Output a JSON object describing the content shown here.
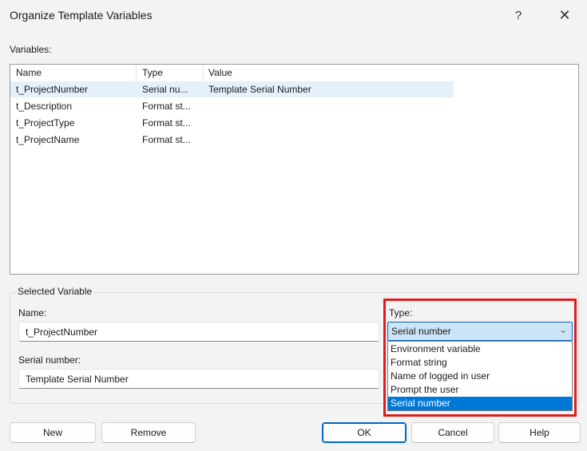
{
  "window": {
    "title": "Organize Template Variables",
    "help_glyph": "?",
    "close_glyph": "✕"
  },
  "variables": {
    "label": "Variables:",
    "columns": [
      "Name",
      "Type",
      "Value"
    ],
    "rows": [
      {
        "name": "t_ProjectNumber",
        "type": "Serial nu...",
        "value": "Template Serial Number"
      },
      {
        "name": "t_Description",
        "type": "Format st...",
        "value": ""
      },
      {
        "name": "t_ProjectType",
        "type": "Format st...",
        "value": ""
      },
      {
        "name": "t_ProjectName",
        "type": "Format st...",
        "value": ""
      }
    ],
    "selected_row": 0
  },
  "selected_variable": {
    "group_label": "Selected Variable",
    "name_label": "Name:",
    "name_value": "t_ProjectNumber",
    "serial_label": "Serial number:",
    "serial_value": "Template Serial Number",
    "type_label": "Type:",
    "type_value": "Serial number",
    "type_options": [
      "Environment variable",
      "Format string",
      "Name of logged in user",
      "Prompt the user",
      "Serial number"
    ],
    "type_selected_index": 4
  },
  "buttons": {
    "new": "New",
    "remove": "Remove",
    "ok": "OK",
    "cancel": "Cancel",
    "help": "Help"
  },
  "colors": {
    "highlight_box": "#e21c1c",
    "selection": "#0078d7",
    "row_selection": "#e5f0fb"
  },
  "icons": {
    "combo_chevron": "chevron-down-icon"
  }
}
